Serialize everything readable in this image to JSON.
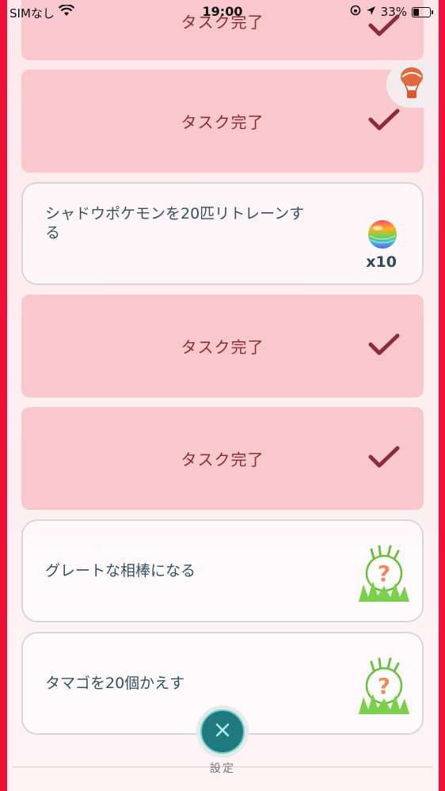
{
  "status_bar": {
    "carrier": "SIMなし",
    "time": "19:00",
    "battery": "33%"
  },
  "tasks": [
    {
      "type": "done",
      "label": "タスク完了"
    },
    {
      "type": "done",
      "label": "タスク完了"
    },
    {
      "type": "task",
      "label": "シャドウポケモンを20匹リトレーンする",
      "reward": "rare-candy-icon",
      "reward_count": "x10"
    },
    {
      "type": "done",
      "label": "タスク完了"
    },
    {
      "type": "done",
      "label": "タスク完了"
    },
    {
      "type": "task",
      "label": "グレートな相棒になる",
      "reward": "mystery-pokemon-icon"
    },
    {
      "type": "task",
      "label": "タマゴを20個かえす",
      "reward": "mystery-pokemon-icon"
    }
  ],
  "bottom": {
    "close_label": "×",
    "settings_label": "設定"
  },
  "colors": {
    "edge": "#f0103a",
    "done_card": "#f8c8cc",
    "done_text": "#8c2b3c",
    "close_button": "#1f7a7d"
  }
}
